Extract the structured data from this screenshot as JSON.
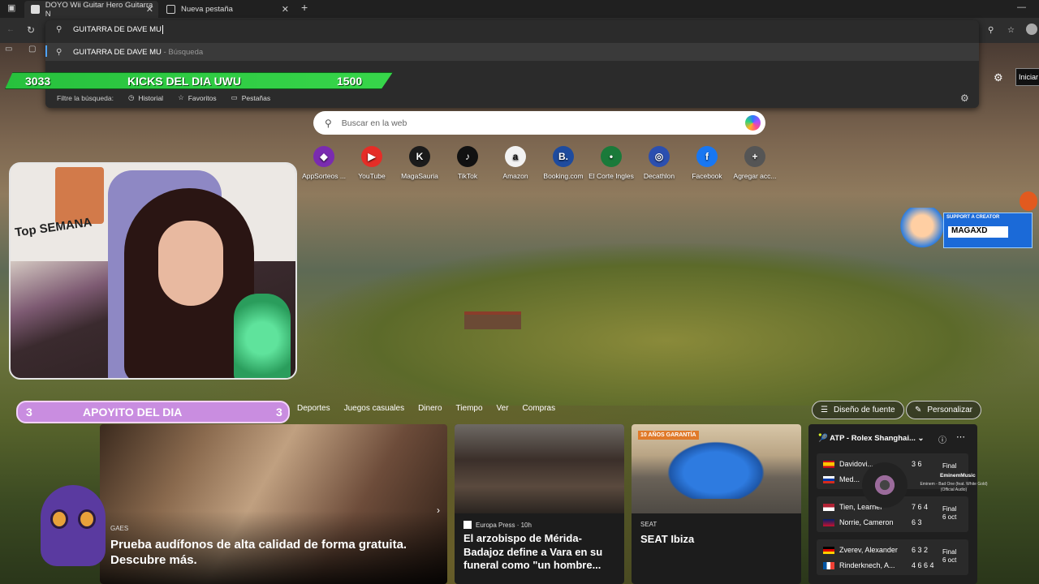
{
  "tabs": [
    {
      "label": "DOYO Wii Guitar Hero Guitarra N",
      "active": true
    },
    {
      "label": "Nueva pestaña",
      "active": false
    }
  ],
  "omnibox": {
    "typed": "GUITARRA DE DAVE MU",
    "suggestion": "GUITARRA DE DAVE MU",
    "suggestion_suffix": " - Búsqueda",
    "filter_label": "Filtre la búsqueda:",
    "filters": [
      "Historial",
      "Favoritos",
      "Pestañas"
    ]
  },
  "kicks": {
    "left": "3033",
    "title": "KICKS DEL DIA UWU",
    "right": "1500"
  },
  "search": {
    "placeholder": "Buscar en la web"
  },
  "shortcuts": [
    {
      "label": "AppSorteos ...",
      "icon": "appsorteos-icon",
      "color": "#7a2bb0",
      "glyph": "◆"
    },
    {
      "label": "YouTube",
      "icon": "youtube-icon",
      "color": "#e52d27",
      "glyph": "▶"
    },
    {
      "label": "MagaSauria",
      "icon": "kick-icon",
      "color": "#1b1b1b",
      "glyph": "K"
    },
    {
      "label": "TikTok",
      "icon": "tiktok-icon",
      "color": "#111111",
      "glyph": "♪"
    },
    {
      "label": "Amazon",
      "icon": "amazon-icon",
      "color": "#f2f2f2",
      "glyph": "a"
    },
    {
      "label": "Booking.com",
      "icon": "booking-icon",
      "color": "#1e4b9e",
      "glyph": "B."
    },
    {
      "label": "El Corte Ingles",
      "icon": "elcorteingles-icon",
      "color": "#1a7a3a",
      "glyph": "•"
    },
    {
      "label": "Decathlon",
      "icon": "decathlon-icon",
      "color": "#2b4fb0",
      "glyph": "◎"
    },
    {
      "label": "Facebook",
      "icon": "facebook-icon",
      "color": "#1877f2",
      "glyph": "f"
    },
    {
      "label": "Agregar acc...",
      "icon": "plus-icon",
      "color": "#555555",
      "glyph": "+"
    }
  ],
  "webcam": {
    "poster_text": "Top SEMANA"
  },
  "apoyito": {
    "left": "3",
    "title": "APOYITO DEL DIA",
    "right": "3"
  },
  "support": {
    "label": "SUPPORT A CREATOR",
    "name": "MAGAXD"
  },
  "news_nav": [
    "Deportes",
    "Juegos casuales",
    "Dinero",
    "Tiempo",
    "Ver",
    "Compras"
  ],
  "buttons": {
    "font": "Diseño de fuente",
    "personalize": "Personalizar",
    "start": "Iniciar"
  },
  "cards": [
    {
      "source": "GAES",
      "title": "Prueba audífonos de alta calidad de forma gratuita. Descubre más."
    },
    {
      "source": "Europa Press · 10h",
      "title": "El arzobispo de Mérida-Badajoz define a Vara en su funeral como \"un hombre..."
    },
    {
      "source": "SEAT",
      "title": "SEAT Ibiza",
      "badge": "10 AÑOS GARANTÍA"
    }
  ],
  "sports": {
    "header": "ATP - Rolex Shanghai...",
    "matches": [
      {
        "p1": "Davidovi...",
        "s1": "3 6",
        "p2": "Med...",
        "s2": "",
        "status": "Final",
        "date": "",
        "f1": "es",
        "f2": "ru"
      },
      {
        "p1": "Tien, Learner",
        "s1": "7 6 4",
        "p2": "Norrie, Cameron",
        "s2": "6 3",
        "status": "Final",
        "date": "6 oct",
        "f1": "us",
        "f2": "gb"
      },
      {
        "p1": "Zverev, Alexander",
        "s1": "6 3 2",
        "p2": "Rinderknech, A...",
        "s2": "4 6 6 4",
        "status": "Final",
        "date": "6 oct",
        "f1": "de",
        "f2": "fr"
      }
    ]
  },
  "nowplaying": {
    "artist": "EminemMusic",
    "track": "Eminem - Bad One (feat. White Gold) (Official Audio)"
  }
}
